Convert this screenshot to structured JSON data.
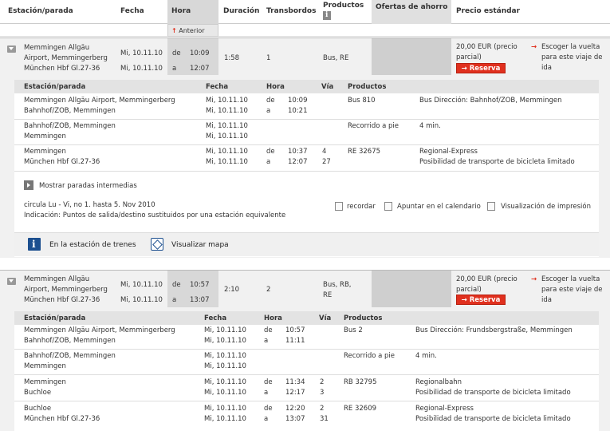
{
  "header": {
    "col_station": "Estación/parada",
    "col_date": "Fecha",
    "col_time": "Hora",
    "col_duration": "Duración",
    "col_transfers": "Transbordos",
    "col_products": "Productos",
    "col_offers": "Ofertas de ahorro",
    "col_price": "Precio estándar",
    "anterior": "Anterior"
  },
  "connections": [
    {
      "from": "Memmingen Allgäu Airport, Memmingerberg",
      "from_l1": "Memmingen Allgäu",
      "from_l2": "Airport, Memmingerberg",
      "to": "München Hbf Gl.27-36",
      "date_dep": "Mi, 10.11.10",
      "date_arr": "Mi, 10.11.10",
      "dep_label": "de",
      "arr_label": "a",
      "dep_time": "10:09",
      "arr_time": "12:07",
      "duration": "1:58",
      "transfers": "1",
      "products": "Bus, RE",
      "price_l1": "20,00 EUR  (precio",
      "price_l2": "parcial)",
      "reserve": "Reserva",
      "choose_l1": "Escoger la vuelta",
      "choose_l2": "para este viaje de",
      "choose_l3": "ida",
      "detail_header": {
        "station": "Estación/parada",
        "date": "Fecha",
        "time": "Hora",
        "platform": "Vía",
        "products": "Productos"
      },
      "legs": [
        {
          "s1": "Memmingen Allgäu Airport, Memmingerberg",
          "s2": "Bahnhof/ZOB, Memmingen",
          "d1": "Mi, 10.11.10",
          "d2": "Mi, 10.11.10",
          "l1": "de",
          "l2": "a",
          "t1": "10:09",
          "t2": "10:21",
          "p1": "",
          "p2": "",
          "prod": "Bus 810",
          "info1": "Bus Dirección: Bahnhof/ZOB, Memmingen",
          "info2": ""
        },
        {
          "s1": "Bahnhof/ZOB, Memmingen",
          "s2": "Memmingen",
          "d1": "Mi, 10.11.10",
          "d2": "Mi, 10.11.10",
          "l1": "",
          "l2": "",
          "t1": "",
          "t2": "",
          "p1": "",
          "p2": "",
          "prod": "Recorrido a pie",
          "info1": "4 min.",
          "info2": ""
        },
        {
          "s1": "Memmingen",
          "s2": "München Hbf Gl.27-36",
          "d1": "Mi, 10.11.10",
          "d2": "Mi, 10.11.10",
          "l1": "de",
          "l2": "a",
          "t1": "10:37",
          "t2": "12:07",
          "p1": "4",
          "p2": "27",
          "prod": "RE 32675",
          "info1": "Regional-Express",
          "info2": "Posibilidad de transporte de bicicleta limitado"
        }
      ],
      "show_stops": "Mostrar paradas intermedias",
      "note1": "circula Lu - Vi, no 1. hasta 5. Nov 2010",
      "note2": "Indicación: Puntos de salida/destino sustituidos por una estación equivalente",
      "remember": "recordar",
      "calendar": "Apuntar en el calendario",
      "print": "Visualización de impresión",
      "at_station": "En la estación de trenes",
      "show_map": "Visualizar mapa"
    },
    {
      "from_l1": "Memmingen Allgäu",
      "from_l2": "Airport, Memmingerberg",
      "to": "München Hbf Gl.27-36",
      "date_dep": "Mi, 10.11.10",
      "date_arr": "Mi, 10.11.10",
      "dep_label": "de",
      "arr_label": "a",
      "dep_time": "10:57",
      "arr_time": "13:07",
      "duration": "2:10",
      "transfers": "2",
      "products_l1": "Bus, RB,",
      "products_l2": "RE",
      "price_l1": "20,00 EUR  (precio",
      "price_l2": "parcial)",
      "reserve": "Reserva",
      "choose_l1": "Escoger la vuelta",
      "choose_l2": "para este viaje de",
      "choose_l3": "ida",
      "detail_header": {
        "station": "Estación/parada",
        "date": "Fecha",
        "time": "Hora",
        "platform": "Vía",
        "products": "Productos"
      },
      "legs": [
        {
          "s1": "Memmingen Allgäu Airport, Memmingerberg",
          "s2": "Bahnhof/ZOB, Memmingen",
          "d1": "Mi, 10.11.10",
          "d2": "Mi, 10.11.10",
          "l1": "de",
          "l2": "a",
          "t1": "10:57",
          "t2": "11:11",
          "p1": "",
          "p2": "",
          "prod": "Bus 2",
          "info1": "Bus Dirección: Frundsbergstraße, Memmingen",
          "info2": ""
        },
        {
          "s1": "Bahnhof/ZOB, Memmingen",
          "s2": "Memmingen",
          "d1": "Mi, 10.11.10",
          "d2": "Mi, 10.11.10",
          "l1": "",
          "l2": "",
          "t1": "",
          "t2": "",
          "p1": "",
          "p2": "",
          "prod": "Recorrido a pie",
          "info1": "4 min.",
          "info2": ""
        },
        {
          "s1": "Memmingen",
          "s2": "Buchloe",
          "d1": "Mi, 10.11.10",
          "d2": "Mi, 10.11.10",
          "l1": "de",
          "l2": "a",
          "t1": "11:34",
          "t2": "12:17",
          "p1": "2",
          "p2": "3",
          "prod": "RB 32795",
          "info1": "Regionalbahn",
          "info2": "Posibilidad de transporte de bicicleta limitado"
        },
        {
          "s1": "Buchloe",
          "s2": "München Hbf Gl.27-36",
          "d1": "Mi, 10.11.10",
          "d2": "Mi, 10.11.10",
          "l1": "de",
          "l2": "a",
          "t1": "12:20",
          "t2": "13:07",
          "p1": "2",
          "p2": "31",
          "prod": "RE 32609",
          "info1": "Regional-Express",
          "info2": "Posibilidad de transporte de bicicleta limitado"
        }
      ]
    }
  ],
  "colors": {
    "accent": "#e0301e",
    "info_blue": "#1c4f8f"
  }
}
